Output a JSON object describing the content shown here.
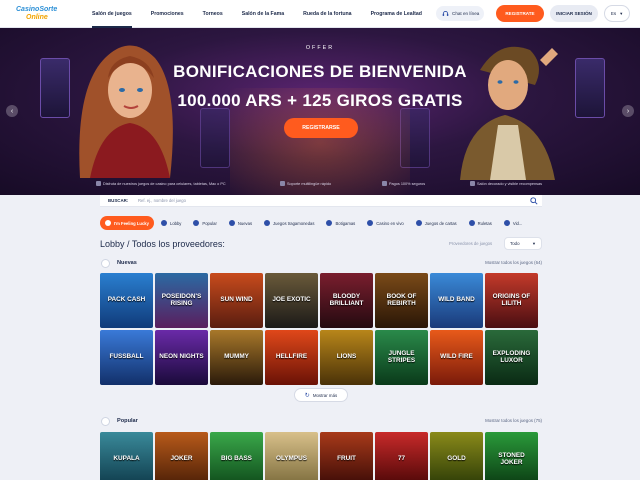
{
  "header": {
    "logo_line1": "CasinoSorte",
    "logo_line2": "Online",
    "nav": [
      "Salón de juegos",
      "Promociones",
      "Torneos",
      "Salón de la Fama",
      "Rueda de la fortuna",
      "Programa de Lealtad"
    ],
    "chat_label": "Chat en línea",
    "register_label": "REGISTRATE",
    "login_label": "INICIAR SESIÓN",
    "lang": "Es"
  },
  "hero": {
    "eyebrow": "OFFER",
    "title_line1": "BONIFICACIONES DE BIENVENIDA",
    "title_line2": "100.000 ARS + 125 GIROS GRATIS",
    "cta": "REGISTRARSE",
    "features": [
      "Disfruta de nuestros juegos de casino para celulares, tabletas, Mac o PC",
      "Soporte multilingüe rápido",
      "Pagos 100% seguros",
      "Salón decorado y visible recompensas"
    ]
  },
  "search": {
    "label": "BUSCAR:",
    "placeholder": "Ref. ej., nombre del juego"
  },
  "filters": [
    {
      "label": "I'm Feeling Lucky",
      "active": true
    },
    {
      "label": "Lobby",
      "active": false
    },
    {
      "label": "Popular",
      "active": false
    },
    {
      "label": "Nuevas",
      "active": false
    },
    {
      "label": "Juegos tragamonedas",
      "active": false
    },
    {
      "label": "Botigamas",
      "active": false
    },
    {
      "label": "Casino en vivo",
      "active": false
    },
    {
      "label": "Juegos de cartas",
      "active": false
    },
    {
      "label": "Ruletas",
      "active": false
    },
    {
      "label": "Vid...",
      "active": false
    }
  ],
  "lobby": {
    "title": "Lobby / Todos los proveedores:",
    "providers_label": "Proveedores de juegos",
    "providers_value": "Todo"
  },
  "sections": {
    "new": {
      "title": "Nuevas",
      "more": "Mostrar todos los juegos (64)",
      "games": [
        "PACK CASH",
        "POSEIDON'S RISING",
        "SUN WIND",
        "JOE EXOTIC",
        "BLOODY BRILLIANT",
        "BOOK OF REBIRTH",
        "WILD BAND",
        "ORIGINS OF LILITH",
        "FUSSBALL",
        "NEON NIGHTS",
        "MUMMY",
        "HELLFIRE",
        "LIONS",
        "JUNGLE STRIPES",
        "WILD FIRE",
        "EXPLODING LUXOR"
      ]
    },
    "show_more": "Mostrar más",
    "popular": {
      "title": "Popular",
      "more": "Mostrar todos los juegos (75)",
      "games": [
        "KUPALA",
        "JOKER",
        "BIG BASS",
        "OLYMPUS",
        "FRUIT",
        "77",
        "GOLD",
        "STONED JOKER"
      ]
    }
  }
}
